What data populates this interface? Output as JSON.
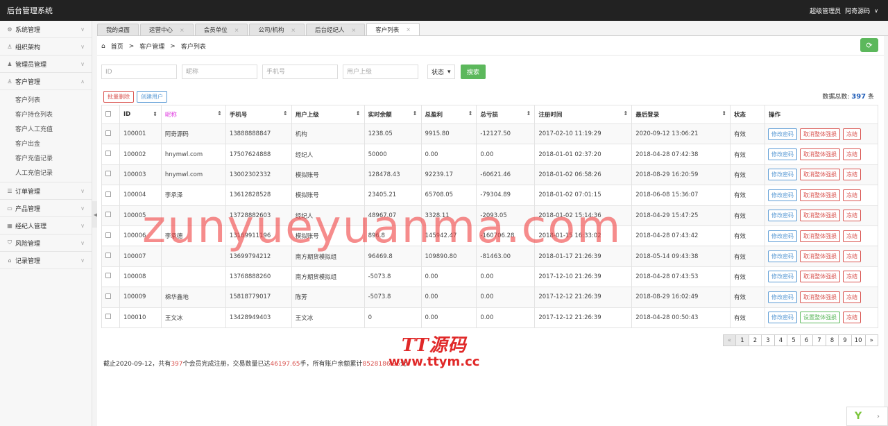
{
  "app": {
    "title": "后台管理系统",
    "user_role": "超级管理员",
    "user_name": "阿奇源码"
  },
  "sidebar": {
    "items": [
      {
        "label": "系统管理",
        "icon": "gear-icon",
        "glyph": "⚙",
        "chev": "∨"
      },
      {
        "label": "组织架构",
        "icon": "user-icon",
        "glyph": "♙",
        "chev": "∨"
      },
      {
        "label": "管理员管理",
        "icon": "admin-icon",
        "glyph": "♟",
        "chev": "∨"
      },
      {
        "label": "客户管理",
        "icon": "customer-icon",
        "glyph": "♙",
        "chev": "∧"
      }
    ],
    "sub_items": [
      "客户列表",
      "客户持仓列表",
      "客户人工充值",
      "客户出金",
      "客户充值记录",
      "人工充值记录"
    ],
    "items_after": [
      {
        "label": "订单管理",
        "icon": "list-icon",
        "glyph": "☰",
        "chev": "∨"
      },
      {
        "label": "产品管理",
        "icon": "folder-icon",
        "glyph": "▭",
        "chev": "∨"
      },
      {
        "label": "经纪人管理",
        "icon": "grid-icon",
        "glyph": "▦",
        "chev": "∨"
      },
      {
        "label": "风险管理",
        "icon": "shield-icon",
        "glyph": "⛉",
        "chev": "∨"
      },
      {
        "label": "记录管理",
        "icon": "lock-icon",
        "glyph": "⌂",
        "chev": "∨"
      }
    ],
    "collapse_glyph": "◀"
  },
  "tabs": [
    {
      "label": "我的桌面",
      "closable": false
    },
    {
      "label": "运营中心",
      "closable": true
    },
    {
      "label": "会员单位",
      "closable": true
    },
    {
      "label": "公司/机构",
      "closable": true
    },
    {
      "label": "后台经纪人",
      "closable": true
    },
    {
      "label": "客户列表",
      "closable": true,
      "active": true
    }
  ],
  "breadcrumb": {
    "home": "首页",
    "sep": ">",
    "level1": "客户管理",
    "level2": "客户列表"
  },
  "filters": {
    "id_placeholder": "ID",
    "nickname_placeholder": "昵称",
    "phone_placeholder": "手机号",
    "parent_placeholder": "用户上级",
    "status_label": "状态",
    "search_label": "搜索"
  },
  "actions": {
    "batch_delete": "批量删除",
    "create_user": "创建用户"
  },
  "total": {
    "label": "数据总数:",
    "count": "397",
    "unit": "条"
  },
  "table": {
    "headers": [
      "ID",
      "昵称",
      "手机号",
      "用户上级",
      "实时余额",
      "总盈利",
      "总亏损",
      "注册时间",
      "最后登录",
      "状态",
      "操作"
    ],
    "rows": [
      {
        "id": "100001",
        "nick": "阿奇源码",
        "phone": "13888888847",
        "parent": "机构",
        "balance": "1238.05",
        "profit": "9915.80",
        "loss": "-12127.50",
        "reg": "2017-02-10 11:19:29",
        "last": "2020-09-12 13:06:21",
        "status": "有效",
        "op1": "修改密码",
        "op2": "取消整体强损",
        "op3": "冻结",
        "op2_green": false
      },
      {
        "id": "100002",
        "nick": "hnymwl.com",
        "phone": "17507624888",
        "parent": "经纪人",
        "balance": "50000",
        "profit": "0.00",
        "loss": "0.00",
        "reg": "2018-01-01 02:37:20",
        "last": "2018-04-28 07:42:38",
        "status": "有效",
        "op1": "修改密码",
        "op2": "取消整体强损",
        "op3": "冻结",
        "op2_green": false
      },
      {
        "id": "100003",
        "nick": "hnymwl.com",
        "phone": "13002302332",
        "parent": "模拟账号",
        "balance": "128478.43",
        "profit": "92239.17",
        "loss": "-60621.46",
        "reg": "2018-01-02 06:58:26",
        "last": "2018-08-29 16:20:59",
        "status": "有效",
        "op1": "修改密码",
        "op2": "取消整体强损",
        "op3": "冻结",
        "op2_green": false
      },
      {
        "id": "100004",
        "nick": "李承泽",
        "phone": "13612828528",
        "parent": "模拟账号",
        "balance": "23405.21",
        "profit": "65708.05",
        "loss": "-79304.89",
        "reg": "2018-01-02 07:01:15",
        "last": "2018-06-08 15:36:07",
        "status": "有效",
        "op1": "修改密码",
        "op2": "取消整体强损",
        "op3": "冻结",
        "op2_green": false
      },
      {
        "id": "100005",
        "nick": "",
        "phone": "13728882603",
        "parent": "经纪人",
        "balance": "48967.07",
        "profit": "3328.11",
        "loss": "-2093.05",
        "reg": "2018-01-02 15:14:36",
        "last": "2018-04-29 15:47:25",
        "status": "有效",
        "op1": "修改密码",
        "op2": "取消整体强损",
        "op3": "冻结",
        "op2_green": false
      },
      {
        "id": "100006",
        "nick": "李承德",
        "phone": "13169911196",
        "parent": "模拟账号",
        "balance": "896.8",
        "profit": "145942.47",
        "loss": "-160706.28",
        "reg": "2018-01-15 16:33:02",
        "last": "2018-04-28 07:43:42",
        "status": "有效",
        "op1": "修改密码",
        "op2": "取消整体强损",
        "op3": "冻结",
        "op2_green": false
      },
      {
        "id": "100007",
        "nick": "",
        "phone": "13699794212",
        "parent": "南方期货模拟组",
        "balance": "96469.8",
        "profit": "109890.80",
        "loss": "-81463.00",
        "reg": "2018-01-17 21:26:39",
        "last": "2018-05-14 09:43:38",
        "status": "有效",
        "op1": "修改密码",
        "op2": "取消整体强损",
        "op3": "冻结",
        "op2_green": false
      },
      {
        "id": "100008",
        "nick": "",
        "phone": "13768888260",
        "parent": "南方期货模拟组",
        "balance": "-5073.8",
        "profit": "0.00",
        "loss": "0.00",
        "reg": "2017-12-10 21:26:39",
        "last": "2018-04-28 07:43:53",
        "status": "有效",
        "op1": "修改密码",
        "op2": "取消整体强损",
        "op3": "冻结",
        "op2_green": false
      },
      {
        "id": "100009",
        "nick": "棉华鑫地",
        "phone": "15818779017",
        "parent": "陈芳",
        "balance": "-5073.8",
        "profit": "0.00",
        "loss": "0.00",
        "reg": "2017-12-12 21:26:39",
        "last": "2018-08-29 16:02:49",
        "status": "有效",
        "op1": "修改密码",
        "op2": "取消整体强损",
        "op3": "冻结",
        "op2_green": false
      },
      {
        "id": "100010",
        "nick": "王文冰",
        "phone": "13428949403",
        "parent": "王文冰",
        "balance": "0",
        "profit": "0.00",
        "loss": "0.00",
        "reg": "2017-12-12 21:26:39",
        "last": "2018-04-28 00:50:43",
        "status": "有效",
        "op1": "修改密码",
        "op2": "设置整体强损",
        "op3": "冻结",
        "op2_green": true
      }
    ]
  },
  "pager": {
    "prev": "«",
    "pages": [
      "1",
      "2",
      "3",
      "4",
      "5",
      "6",
      "7",
      "8",
      "9",
      "10"
    ],
    "next": "»",
    "current": "1"
  },
  "summary": {
    "p1": "截止2020-09-12，共有",
    "users": "397",
    "p2": "个会员完成注册，交易数量已达",
    "volume": "46197.65",
    "p3": "手，所有账户余额累计",
    "balance": "8528186.96",
    "p4": "元"
  },
  "watermark": {
    "text": "zunyueyuanma.com",
    "logo_line1": "TT源码",
    "logo_line2": "www.ttym.cc"
  },
  "colors": {
    "accent_green": "#5cb85c",
    "danger_red": "#d9534f",
    "link_blue": "#5b9bd5",
    "topbar": "#222222"
  }
}
